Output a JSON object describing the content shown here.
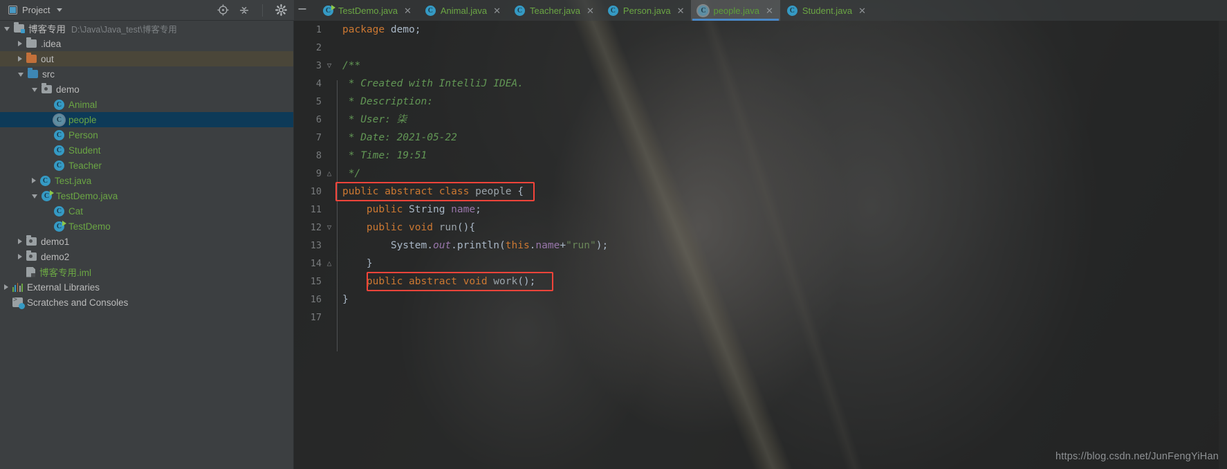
{
  "window": {
    "tool_window_title": "Project",
    "watermark": "https://blog.csdn.net/JunFengYiHan"
  },
  "toolbar": {
    "locate_icon": "crosshair-target-icon",
    "collapse_icon": "collapse-all-icon",
    "settings_icon": "gear-icon",
    "hide_icon": "minimize-icon"
  },
  "sidebar": {
    "items": [
      {
        "label": "博客专用",
        "path": "D:\\Java\\Java_test\\博客专用",
        "indent": 0,
        "arrow": "open",
        "icon": "project-folder",
        "color": "grey",
        "state": "normal"
      },
      {
        "label": ".idea",
        "path": "",
        "indent": 1,
        "arrow": "closed",
        "icon": "folder",
        "color": "grey",
        "state": "normal"
      },
      {
        "label": "out",
        "path": "",
        "indent": 1,
        "arrow": "closed",
        "icon": "folder-orange",
        "color": "grey",
        "state": "out-highlight"
      },
      {
        "label": "src",
        "path": "",
        "indent": 1,
        "arrow": "open",
        "icon": "folder-blue",
        "color": "grey",
        "state": "normal"
      },
      {
        "label": "demo",
        "path": "",
        "indent": 2,
        "arrow": "open",
        "icon": "package",
        "color": "grey",
        "state": "normal"
      },
      {
        "label": "Animal",
        "path": "",
        "indent": 3,
        "arrow": "none",
        "icon": "class",
        "color": "green",
        "state": "normal"
      },
      {
        "label": "people",
        "path": "",
        "indent": 3,
        "arrow": "none",
        "icon": "abstract-class",
        "color": "green",
        "state": "selected"
      },
      {
        "label": "Person",
        "path": "",
        "indent": 3,
        "arrow": "none",
        "icon": "class",
        "color": "green",
        "state": "normal"
      },
      {
        "label": "Student",
        "path": "",
        "indent": 3,
        "arrow": "none",
        "icon": "class",
        "color": "green",
        "state": "normal"
      },
      {
        "label": "Teacher",
        "path": "",
        "indent": 3,
        "arrow": "none",
        "icon": "class",
        "color": "green",
        "state": "normal"
      },
      {
        "label": "Test.java",
        "path": "",
        "indent": 2,
        "arrow": "closed",
        "icon": "class",
        "color": "green",
        "state": "normal"
      },
      {
        "label": "TestDemo.java",
        "path": "",
        "indent": 2,
        "arrow": "open",
        "icon": "class-runnable",
        "color": "green",
        "state": "normal"
      },
      {
        "label": "Cat",
        "path": "",
        "indent": 3,
        "arrow": "none",
        "icon": "class",
        "color": "green",
        "state": "normal"
      },
      {
        "label": "TestDemo",
        "path": "",
        "indent": 3,
        "arrow": "none",
        "icon": "class-runnable",
        "color": "green",
        "state": "normal"
      },
      {
        "label": "demo1",
        "path": "",
        "indent": 1,
        "arrow": "closed",
        "icon": "package",
        "color": "grey",
        "state": "normal"
      },
      {
        "label": "demo2",
        "path": "",
        "indent": 1,
        "arrow": "closed",
        "icon": "package",
        "color": "grey",
        "state": "normal"
      },
      {
        "label": "博客专用.iml",
        "path": "",
        "indent": 1,
        "arrow": "none",
        "icon": "iml-file",
        "color": "green",
        "state": "normal"
      },
      {
        "label": "External Libraries",
        "path": "",
        "indent": 0,
        "arrow": "closed",
        "icon": "libraries",
        "color": "grey",
        "state": "normal"
      },
      {
        "label": "Scratches and Consoles",
        "path": "",
        "indent": 0,
        "arrow": "none",
        "icon": "scratches",
        "color": "grey",
        "state": "normal"
      }
    ]
  },
  "tabs": [
    {
      "label": "TestDemo.java",
      "icon": "class-runnable",
      "active": false
    },
    {
      "label": "Animal.java",
      "icon": "class",
      "active": false
    },
    {
      "label": "Teacher.java",
      "icon": "class",
      "active": false
    },
    {
      "label": "Person.java",
      "icon": "class",
      "active": false
    },
    {
      "label": "people.java",
      "icon": "abstract-class",
      "active": true
    },
    {
      "label": "Student.java",
      "icon": "class",
      "active": false
    }
  ],
  "editor": {
    "file": "people.java",
    "line_numbers": [
      1,
      2,
      3,
      4,
      5,
      6,
      7,
      8,
      9,
      10,
      11,
      12,
      13,
      14,
      15,
      16,
      17
    ],
    "lines": [
      {
        "n": 1,
        "text": "package demo;"
      },
      {
        "n": 2,
        "text": ""
      },
      {
        "n": 3,
        "text": "/**"
      },
      {
        "n": 4,
        "text": " * Created with IntelliJ IDEA."
      },
      {
        "n": 5,
        "text": " * Description:"
      },
      {
        "n": 6,
        "text": " * User: 柒"
      },
      {
        "n": 7,
        "text": " * Date: 2021-05-22"
      },
      {
        "n": 8,
        "text": " * Time: 19:51"
      },
      {
        "n": 9,
        "text": " */"
      },
      {
        "n": 10,
        "text": "public abstract class people {"
      },
      {
        "n": 11,
        "text": "    public String name;"
      },
      {
        "n": 12,
        "text": "    public void run(){"
      },
      {
        "n": 13,
        "text": "        System.out.println(this.name+\"run\");"
      },
      {
        "n": 14,
        "text": "    }"
      },
      {
        "n": 15,
        "text": "    public abstract void work();"
      },
      {
        "n": 16,
        "text": "}"
      },
      {
        "n": 17,
        "text": ""
      }
    ],
    "highlights": [
      {
        "line": 10,
        "note": "public abstract class people {"
      },
      {
        "line": 15,
        "note": "public abstract void work();"
      }
    ]
  },
  "colors": {
    "accent_blue": "#4a88c7",
    "highlight_red": "#f5443a",
    "selection_blue": "#0d3a58",
    "keyword_orange": "#cc7832",
    "comment_green": "#629755",
    "string_green": "#6a8759",
    "field_purple": "#9876aa",
    "identifier": "#a9b7c6",
    "tab_green": "#6ba644",
    "panel_bg": "#3c3f41",
    "editor_bg": "#2b2b2b"
  }
}
